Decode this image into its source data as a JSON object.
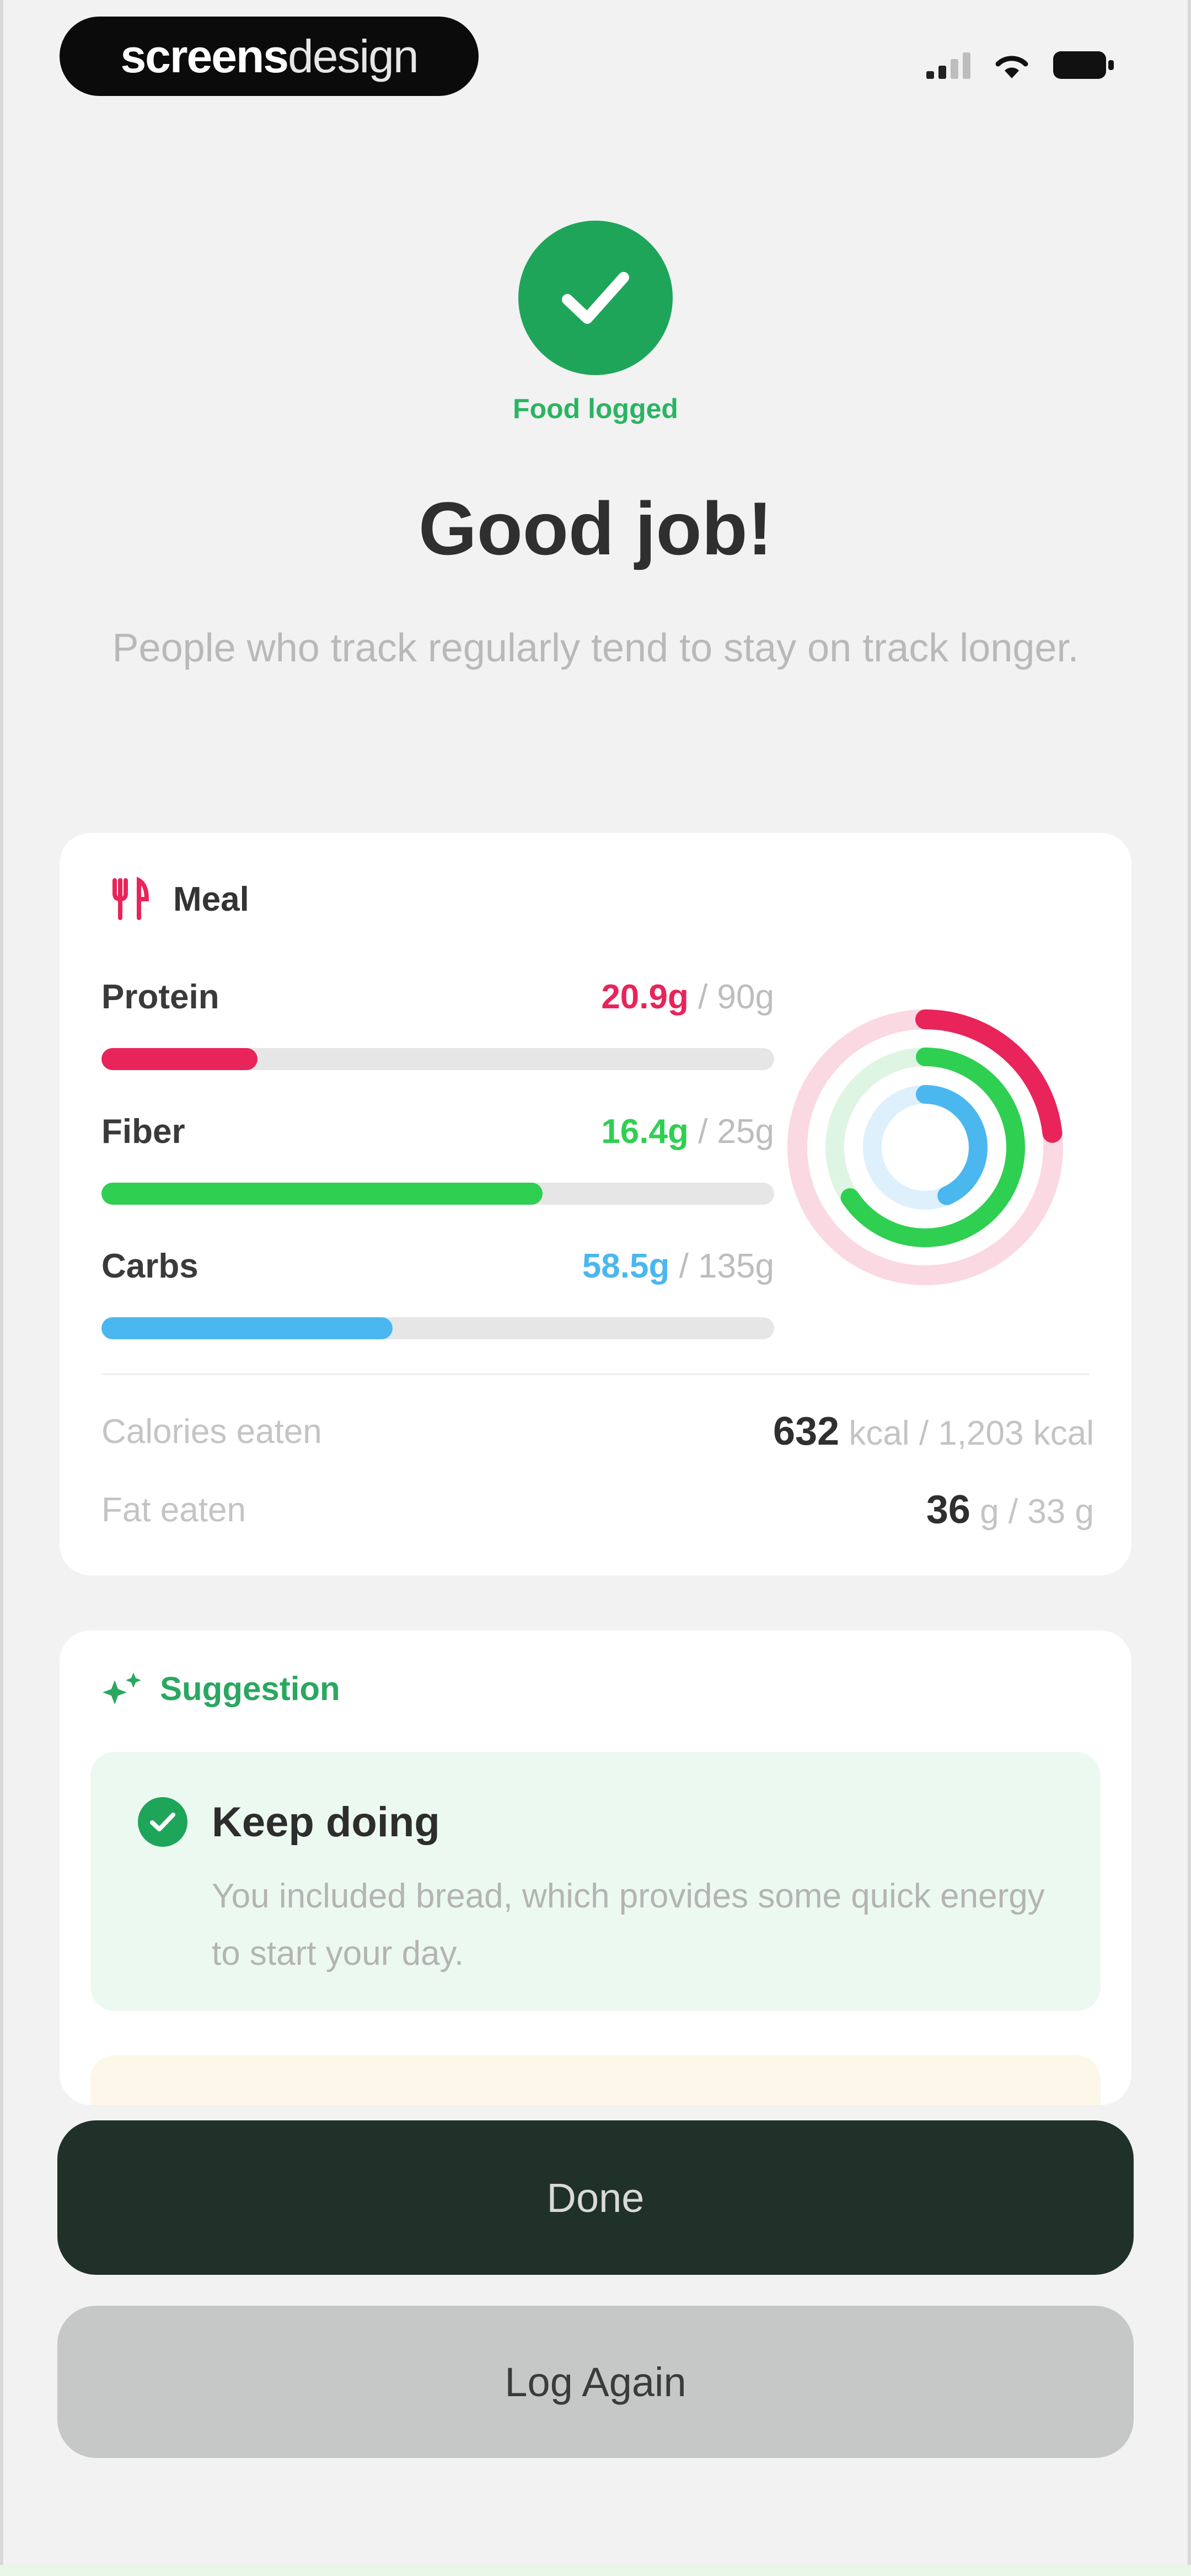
{
  "status_bar": {
    "brand_part1": "screens",
    "brand_part2": "design"
  },
  "hero": {
    "logged_label": "Food logged",
    "title": "Good job!",
    "subtitle": "People who track regularly tend to stay on track longer."
  },
  "meal_card": {
    "header_label": "Meal",
    "header_icon": "fork-knife-icon",
    "nutrients": [
      {
        "name": "Protein",
        "eaten": "20.9g",
        "target": "/ 90g",
        "color": "#e8245a",
        "progress": 0.232
      },
      {
        "name": "Fiber",
        "eaten": "16.4g",
        "target": "/ 25g",
        "color": "#2fcf52",
        "progress": 0.656
      },
      {
        "name": "Carbs",
        "eaten": "58.5g",
        "target": "/ 135g",
        "color": "#4bb7ef",
        "progress": 0.433
      }
    ],
    "stats": [
      {
        "label": "Calories eaten",
        "value": "632",
        "unit": "kcal / 1,203 kcal"
      },
      {
        "label": "Fat eaten",
        "value": "36",
        "unit": "g / 33 g"
      }
    ]
  },
  "suggestion_card": {
    "header_label": "Suggestion",
    "header_icon": "sparkle-icon",
    "tip": {
      "title": "Keep doing",
      "body": "You included bread, which provides some quick energy to start your day."
    }
  },
  "actions": {
    "done_label": "Done",
    "log_again_label": "Log Again"
  }
}
